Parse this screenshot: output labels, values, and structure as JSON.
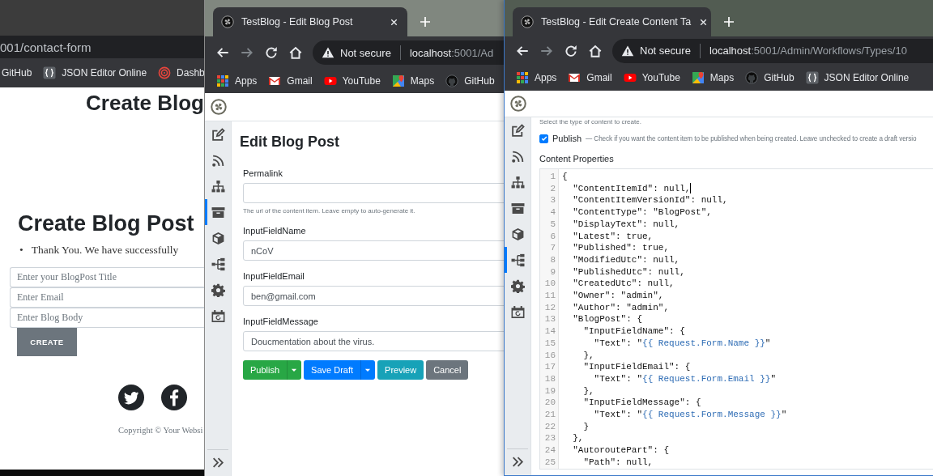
{
  "contact_window": {
    "url": "001/contact-form",
    "bookmarks": [
      {
        "label": "GitHub"
      },
      {
        "kind": "json",
        "label": "JSON Editor Online"
      },
      {
        "kind": "dashboard",
        "label": "Dashb"
      }
    ],
    "page": {
      "banner_heading": "Create Blog",
      "heading": "Create Blog Post",
      "messages": [
        {
          "marker": "•",
          "text": "Thank You. We have successfully"
        }
      ],
      "fields": [
        {
          "placeholder": "Enter your BlogPost Title"
        },
        {
          "placeholder": "Enter Email"
        },
        {
          "placeholder": "Enter Blog Body"
        }
      ],
      "submit": "CREATE",
      "social": [
        {
          "kind": "twitter"
        },
        {
          "kind": "facebook"
        }
      ],
      "copyright": "Copyright © Your Websi"
    }
  },
  "edit_window": {
    "tab": {
      "title": "TestBlog - Edit Blog Post"
    },
    "security": "Not secure",
    "host": "localhost",
    "path": ":5001/Ad",
    "bookmarks": [
      {
        "kind": "apps",
        "label": "Apps"
      },
      {
        "kind": "gmail",
        "label": "Gmail"
      },
      {
        "kind": "youtube",
        "label": "YouTube"
      },
      {
        "kind": "maps",
        "label": "Maps"
      },
      {
        "kind": "github",
        "label": "GitHub"
      }
    ],
    "sidebar": [
      {
        "selected": false
      },
      {
        "selected": false
      },
      {
        "selected": false
      },
      {
        "selected": true
      },
      {
        "selected": false
      },
      {
        "selected": false
      },
      {
        "selected": false
      },
      {
        "selected": false
      }
    ],
    "form": {
      "title": "Edit Blog Post",
      "fields": [
        {
          "label": "Permalink",
          "hint": "The url of the content item. Leave empty to auto-generate it."
        },
        {
          "label": "InputFieldName",
          "value": "nCoV"
        },
        {
          "label": "InputFieldEmail",
          "value": "ben@gmail.com"
        },
        {
          "label": "InputFieldMessage",
          "value": "Doucmentation about the virus."
        }
      ],
      "actions": [
        {
          "label": "Publish",
          "kind": "split",
          "color": "#28a745"
        },
        {
          "label": "Save Draft",
          "kind": "split",
          "color": "#007bff"
        },
        {
          "label": "Preview",
          "kind": "plain",
          "color": "#17a2b8"
        },
        {
          "label": "Cancel",
          "kind": "plain",
          "color": "#6c757d"
        }
      ]
    }
  },
  "workflow_window": {
    "tab": {
      "title": "TestBlog - Edit Create Content Ta"
    },
    "security": "Not secure",
    "host": "localhost",
    "path": ":5001/Admin/Workflows/Types/10",
    "bookmarks": [
      {
        "kind": "apps",
        "label": "Apps"
      },
      {
        "kind": "gmail",
        "label": "Gmail"
      },
      {
        "kind": "youtube",
        "label": "YouTube"
      },
      {
        "kind": "maps",
        "label": "Maps"
      },
      {
        "kind": "github",
        "label": "GitHub"
      },
      {
        "kind": "json",
        "label": "JSON Editor Online"
      }
    ],
    "sidebar": [
      {
        "selected": false
      },
      {
        "selected": false
      },
      {
        "selected": false
      },
      {
        "selected": false
      },
      {
        "selected": false
      },
      {
        "selected": true
      },
      {
        "selected": false
      },
      {
        "selected": false
      }
    ],
    "editor": {
      "hint": "Select the type of content to create.",
      "publish": {
        "checked": true,
        "label": "Publish",
        "description": "— Check if you want the content item to be published when being created. Leave unchecked to create a draft versio"
      },
      "section_title": "Content Properties",
      "lines": [
        {
          "number": "1",
          "text": "{"
        },
        {
          "number": "2",
          "text": "  \"ContentItemId\": null,",
          "cursor": true
        },
        {
          "number": "3",
          "text": "  \"ContentItemVersionId\": null,"
        },
        {
          "number": "4",
          "text": "  \"ContentType\": \"BlogPost\","
        },
        {
          "number": "5",
          "text": "  \"DisplayText\": null,"
        },
        {
          "number": "6",
          "text": "  \"Latest\": true,"
        },
        {
          "number": "7",
          "text": "  \"Published\": true,"
        },
        {
          "number": "8",
          "text": "  \"ModifiedUtc\": null,"
        },
        {
          "number": "9",
          "text": "  \"PublishedUtc\": null,"
        },
        {
          "number": "10",
          "text": "  \"CreatedUtc\": null,"
        },
        {
          "number": "11",
          "text": "  \"Owner\": \"admin\","
        },
        {
          "number": "12",
          "text": "  \"Author\": \"admin\","
        },
        {
          "number": "13",
          "text": "  \"BlogPost\": {"
        },
        {
          "number": "14",
          "text": "    \"InputFieldName\": {"
        },
        {
          "number": "15",
          "text": "      \"Text\": \"",
          "template": "{{ Request.Form.Name }}",
          "tail": "\""
        },
        {
          "number": "16",
          "text": "    },"
        },
        {
          "number": "17",
          "text": "    \"InputFieldEmail\": {"
        },
        {
          "number": "18",
          "text": "      \"Text\": \"",
          "template": "{{ Request.Form.Email }}",
          "tail": "\""
        },
        {
          "number": "19",
          "text": "    },"
        },
        {
          "number": "20",
          "text": "    \"InputFieldMessage\": {"
        },
        {
          "number": "21",
          "text": "      \"Text\": \"",
          "template": "{{ Request.Form.Message }}",
          "tail": "\""
        },
        {
          "number": "22",
          "text": "    }"
        },
        {
          "number": "23",
          "text": "  },"
        },
        {
          "number": "24",
          "text": "  \"AutoroutePart\": {"
        },
        {
          "number": "25",
          "text": "    \"Path\": null,"
        }
      ]
    }
  }
}
